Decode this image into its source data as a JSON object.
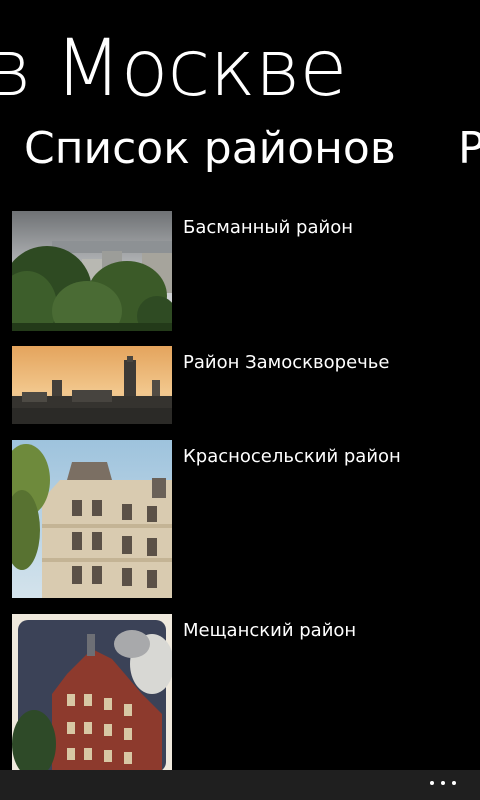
{
  "panorama": {
    "title": "в Москве"
  },
  "pivot": {
    "current": "Список районов",
    "next_peek": "Р"
  },
  "districts": [
    {
      "name": "Басманный район",
      "image": "basmanny-photo"
    },
    {
      "name": "Район Замоскворечье",
      "image": "zamoskvorechye-photo"
    },
    {
      "name": "Красносельский район",
      "image": "krasnoselsky-photo"
    },
    {
      "name": "Мещанский район",
      "image": "meshchansky-photo"
    }
  ],
  "appbar": {
    "more_icon": "more-dots-icon"
  }
}
